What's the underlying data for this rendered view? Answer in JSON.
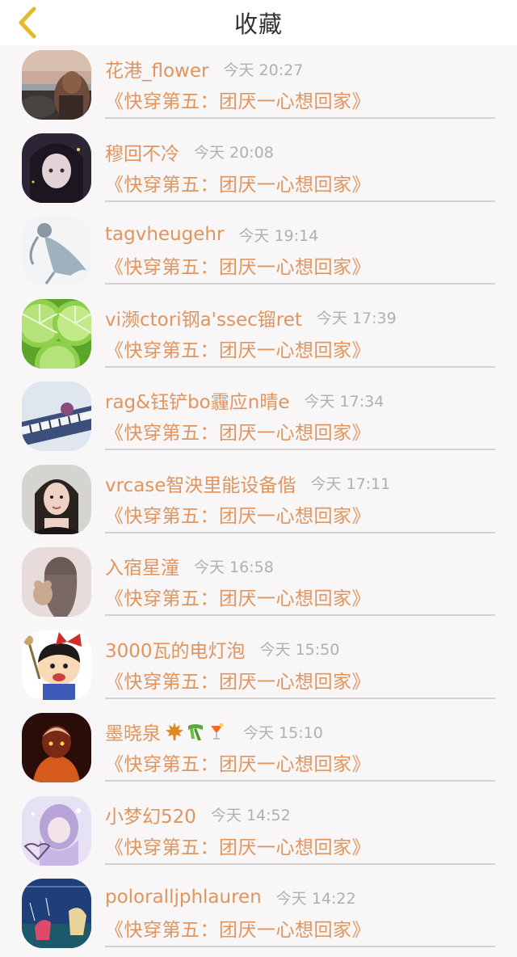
{
  "header": {
    "title": "收藏",
    "back_icon": "chevron-left-icon",
    "accent": "#e0955e"
  },
  "colors": {
    "username": "#e0955e",
    "book_title": "#e0955e",
    "time": "#b0b0b0",
    "back_icon": "#e2ba2c"
  },
  "items": [
    {
      "user": "花港_flower",
      "time": "今天 20:27",
      "book": "《快穿第五：团厌一心想回家》"
    },
    {
      "user": "穆回不冷",
      "time": "今天 20:08",
      "book": "《快穿第五：团厌一心想回家》"
    },
    {
      "user": "tagvheugehr",
      "time": "今天 19:14",
      "book": "《快穿第五：团厌一心想回家》"
    },
    {
      "user": "vi濒ctori钢a'ssec镏ret",
      "time": "今天 17:39",
      "book": "《快穿第五：团厌一心想回家》"
    },
    {
      "user": "rag&钰铲bo霾应n晴e",
      "time": "今天 17:34",
      "book": "《快穿第五：团厌一心想回家》"
    },
    {
      "user": "vrcase智泱里能设备偕",
      "time": "今天 17:11",
      "book": "《快穿第五：团厌一心想回家》"
    },
    {
      "user": "入宿星潼",
      "time": "今天 16:58",
      "book": "《快穿第五：团厌一心想回家》"
    },
    {
      "user": "3000瓦的电灯泡",
      "time": "今天 15:50",
      "book": "《快穿第五：团厌一心想回家》"
    },
    {
      "user": "墨晓泉",
      "emoji": [
        "maple-leaf-icon",
        "scarf-icon",
        "cocktail-icon"
      ],
      "time": "今天 15:10",
      "book": "《快穿第五：团厌一心想回家》"
    },
    {
      "user": "小梦幻520",
      "time": "今天 14:52",
      "book": "《快穿第五：团厌一心想回家》"
    },
    {
      "user": "poloralljphlauren",
      "time": "今天 14:22",
      "book": "《快穿第五：团厌一心想回家》"
    }
  ]
}
